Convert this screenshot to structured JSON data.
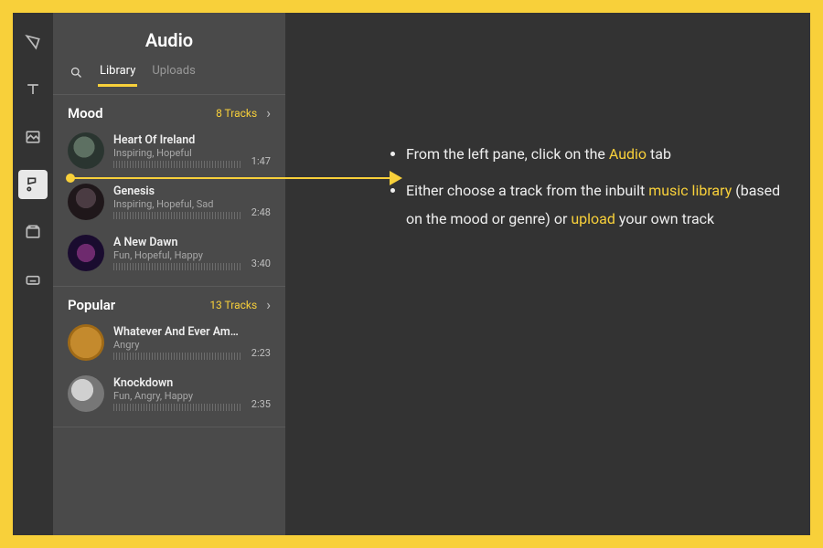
{
  "rail": [
    {
      "id": "templates-icon",
      "active": false
    },
    {
      "id": "text-icon",
      "active": false
    },
    {
      "id": "image-icon",
      "active": false
    },
    {
      "id": "audio-icon",
      "active": true
    },
    {
      "id": "video-icon",
      "active": false
    },
    {
      "id": "caption-icon",
      "active": false
    }
  ],
  "panel": {
    "title": "Audio",
    "tabs": [
      {
        "id": "library",
        "label": "Library",
        "active": true
      },
      {
        "id": "uploads",
        "label": "Uploads",
        "active": false
      }
    ]
  },
  "sections": [
    {
      "title": "Mood",
      "count_label": "8 Tracks",
      "tracks": [
        {
          "name": "Heart Of Ireland",
          "tags": "Inspiring, Hopeful",
          "duration": "1:47",
          "art": "a1"
        },
        {
          "name": "Genesis",
          "tags": "Inspiring, Hopeful, Sad",
          "duration": "2:48",
          "art": "a2"
        },
        {
          "name": "A New Dawn",
          "tags": "Fun, Hopeful, Happy",
          "duration": "3:40",
          "art": "a3"
        }
      ]
    },
    {
      "title": "Popular",
      "count_label": "13 Tracks",
      "tracks": [
        {
          "name": "Whatever And Ever Amen",
          "tags": "Angry",
          "duration": "2:23",
          "art": "a4"
        },
        {
          "name": "Knockdown",
          "tags": "Fun, Angry, Happy",
          "duration": "2:35",
          "art": "a5"
        }
      ]
    }
  ],
  "instructions": {
    "item1_pre": "From the left pane, click on the ",
    "item1_hl": "Audio",
    "item1_post": " tab",
    "item2_pre": "Either choose a track from the inbuilt ",
    "item2_hl1": "music library",
    "item2_mid": "  (based on the mood or genre) or ",
    "item2_hl2": "upload",
    "item2_post": " your own track"
  }
}
